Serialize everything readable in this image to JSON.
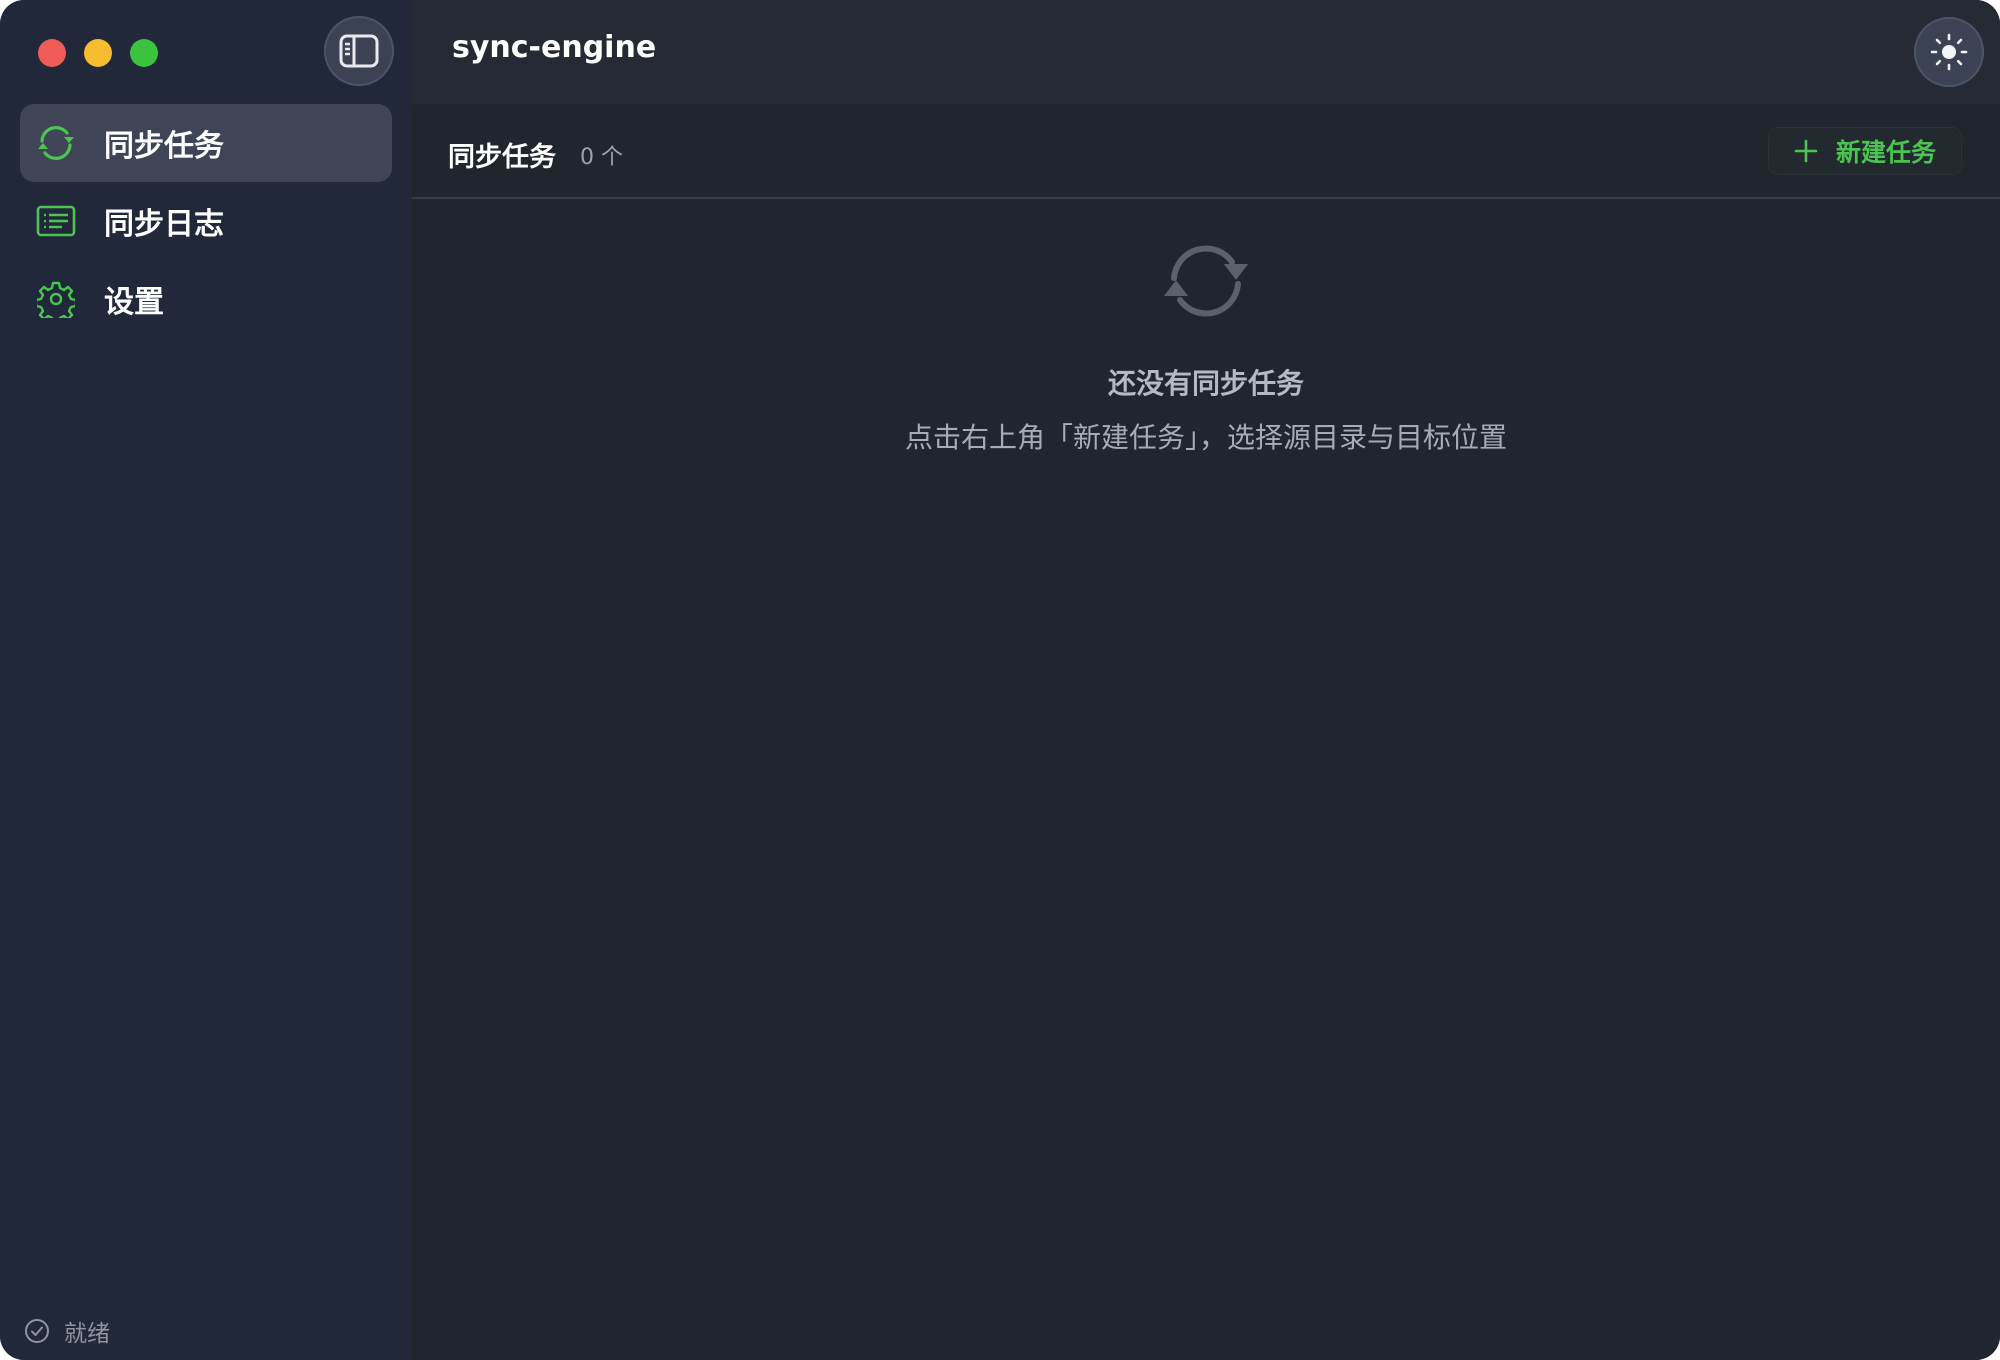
{
  "window": {
    "app_title": "sync-engine"
  },
  "sidebar": {
    "items": [
      {
        "label": "同步任务",
        "icon": "sync-icon",
        "active": true
      },
      {
        "label": "同步日志",
        "icon": "log-list-icon",
        "active": false
      },
      {
        "label": "设置",
        "icon": "gear-icon",
        "active": false
      }
    ],
    "status": "就绪"
  },
  "section": {
    "title": "同步任务",
    "count": "0 个",
    "new_task_label": "新建任务"
  },
  "empty_state": {
    "title": "还没有同步任务",
    "hint": "点击右上角「新建任务」，选择源目录与目标位置"
  },
  "colors": {
    "accent": "#4cc451",
    "sidebar_bg": "#212839",
    "main_bg": "#21252e",
    "traffic_close": "#ee5c55",
    "traffic_min": "#f5bd2f",
    "traffic_max": "#3bc33f"
  }
}
